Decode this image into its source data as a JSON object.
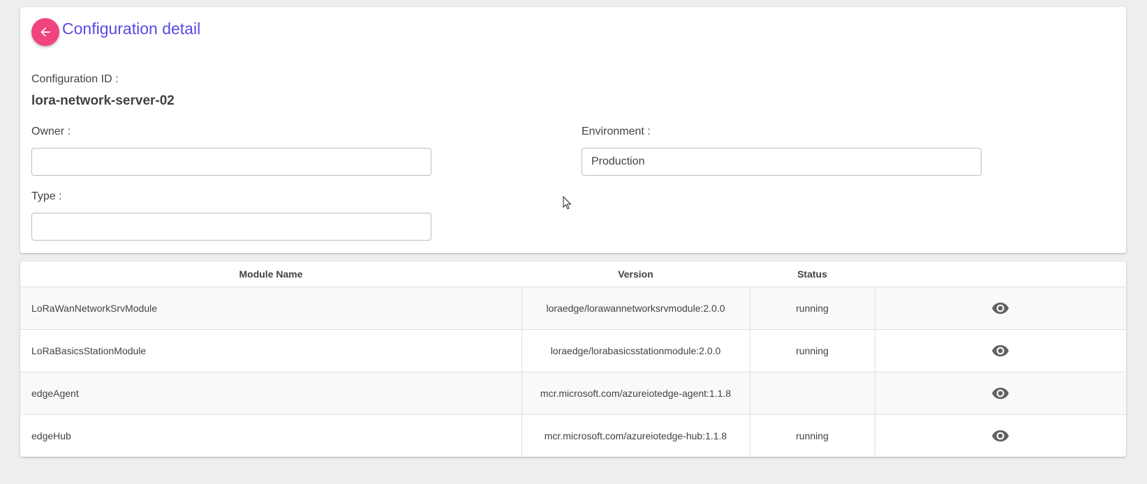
{
  "header": {
    "title": "Configuration detail",
    "back_icon": "arrow-left-icon",
    "accent_color": "#f0437f",
    "title_color": "#594ae2"
  },
  "form": {
    "config_id_label": "Configuration ID :",
    "config_id_value": "lora-network-server-02",
    "owner_label": "Owner :",
    "owner_value": "",
    "environment_label": "Environment :",
    "environment_value": "Production",
    "type_label": "Type :",
    "type_value": ""
  },
  "modules_table": {
    "columns": [
      "Module Name",
      "Version",
      "Status",
      ""
    ],
    "action_icon": "eye-icon",
    "rows": [
      {
        "name": "LoRaWanNetworkSrvModule",
        "version": "loraedge/lorawannetworksrvmodule:2.0.0",
        "status": "running"
      },
      {
        "name": "LoRaBasicsStationModule",
        "version": "loraedge/lorabasicsstationmodule:2.0.0",
        "status": "running"
      },
      {
        "name": "edgeAgent",
        "version": "mcr.microsoft.com/azureiotedge-agent:1.1.8",
        "status": ""
      },
      {
        "name": "edgeHub",
        "version": "mcr.microsoft.com/azureiotedge-hub:1.1.8",
        "status": "running"
      }
    ]
  }
}
